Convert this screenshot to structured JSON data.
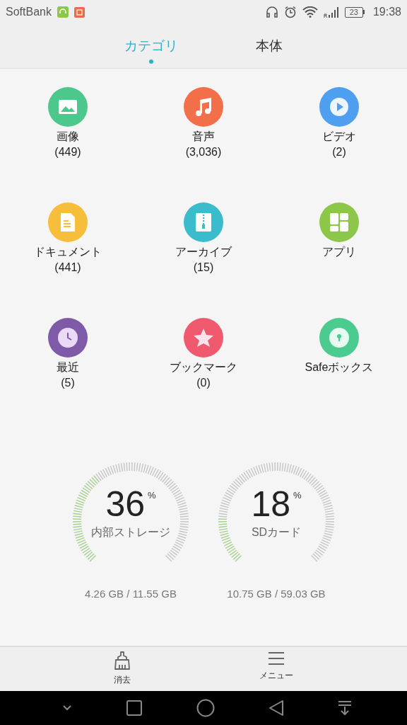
{
  "status_bar": {
    "carrier": "SoftBank",
    "battery": "23",
    "time": "19:38"
  },
  "tabs": [
    {
      "label": "カテゴリ",
      "selected": true
    },
    {
      "label": "本体",
      "selected": false
    }
  ],
  "categories": [
    {
      "kind": "image",
      "color": "#4dc88d",
      "label": "画像",
      "count": "(449)"
    },
    {
      "kind": "music",
      "color": "#f26f4a",
      "label": "音声",
      "count": "(3,036)"
    },
    {
      "kind": "video",
      "color": "#4e9ff0",
      "label": "ビデオ",
      "count": "(2)"
    },
    {
      "kind": "document",
      "color": "#f6be3a",
      "label": "ドキュメント",
      "count": "(441)"
    },
    {
      "kind": "archive",
      "color": "#3bbccc",
      "label": "アーカイブ",
      "count": "(15)"
    },
    {
      "kind": "apps",
      "color": "#8cc74a",
      "label": "アプリ"
    },
    {
      "kind": "recent",
      "color": "#7e5aa8",
      "label": "最近",
      "count": "(5)"
    },
    {
      "kind": "bookmark",
      "color": "#ef5a6f",
      "label": "ブックマーク",
      "count": "(0)"
    },
    {
      "kind": "safe",
      "color": "#4bcb8f",
      "label": "Safeボックス"
    }
  ],
  "storage": [
    {
      "percent": "36",
      "unit": "%",
      "name": "内部ストレージ",
      "usage": "4.26 GB / 11.55 GB"
    },
    {
      "percent": "18",
      "unit": "%",
      "name": "SDカード",
      "usage": "10.75 GB / 59.03 GB"
    }
  ],
  "bottom_bar": [
    {
      "kind": "clean",
      "label": "消去"
    },
    {
      "kind": "menu",
      "label": "メニュー"
    }
  ]
}
